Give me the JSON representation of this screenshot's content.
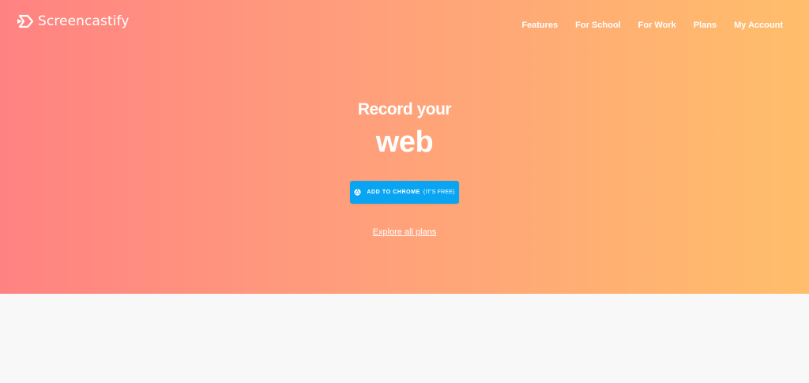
{
  "brand": {
    "logo_text": "Screencastify",
    "icon": "screencastify-logo-icon"
  },
  "nav": {
    "items": [
      {
        "label": "Features"
      },
      {
        "label": "For School"
      },
      {
        "label": "For Work"
      },
      {
        "label": "Plans"
      },
      {
        "label": "My Account"
      }
    ]
  },
  "hero": {
    "headline_line1": "Record your",
    "headline_line2": "web",
    "cta": {
      "icon": "chrome-icon",
      "label": "ADD TO CHROME",
      "sublabel": "(IT'S FREE)"
    },
    "secondary_link": "Explore all plans"
  },
  "colors": {
    "gradient_start": "#ff8282",
    "gradient_end": "#ffbe6b",
    "button": "#0aa5f2",
    "text": "#ffffff",
    "page_background": "#f8f8f8"
  }
}
